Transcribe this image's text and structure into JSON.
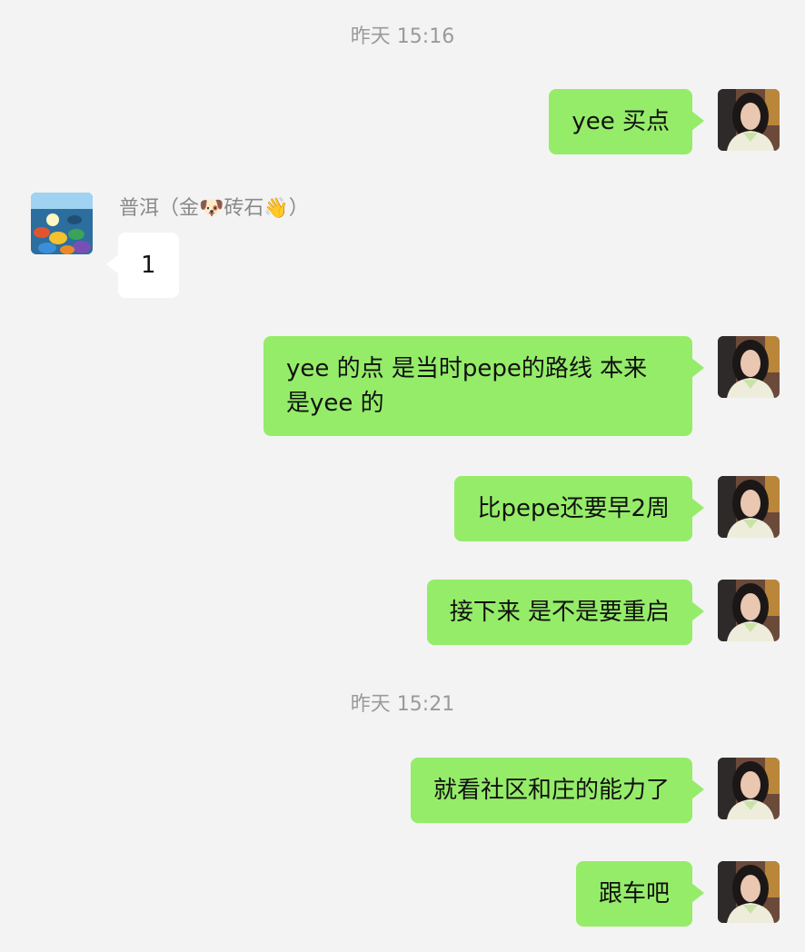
{
  "timestamps": [
    "昨天 15:16",
    "昨天 15:21"
  ],
  "contact": {
    "name": "普洱（金🐶砖石👋）"
  },
  "messages": [
    {
      "from": "me",
      "text": "yee 买点"
    },
    {
      "from": "other",
      "text": "1"
    },
    {
      "from": "me",
      "text": "yee 的点 是当时pepe的路线 本来是yee 的"
    },
    {
      "from": "me",
      "text": "比pepe还要早2周"
    },
    {
      "from": "me",
      "text": "接下来 是不是要重启"
    },
    {
      "from": "me",
      "text": "就看社区和庄的能力了"
    },
    {
      "from": "me",
      "text": "跟车吧"
    }
  ],
  "colors": {
    "background": "#f3f3f3",
    "my_bubble": "#95ec69",
    "other_bubble": "#ffffff",
    "timestamp_text": "#9a9a9a"
  },
  "icons": {
    "my_avatar": "user-avatar-icon",
    "contact_avatar": "contact-avatar-icon"
  }
}
